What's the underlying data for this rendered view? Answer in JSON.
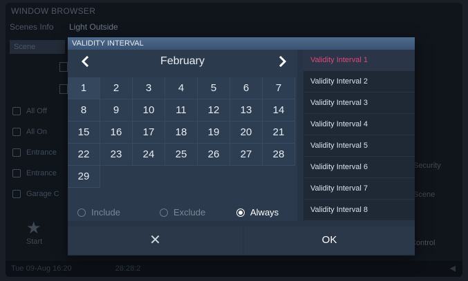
{
  "background": {
    "title": "WINDOW BROWSER",
    "row_label": "Scenes Info",
    "row_value": "Light Outside",
    "tab": "Scene",
    "items": [
      "All Off",
      "All On",
      "Entrance",
      "Entrance",
      "Garage C"
    ],
    "star_label": "Start",
    "right_labels": [
      "Security",
      "Scene",
      "Control"
    ],
    "status_left": "Tue 09-Aug  16:20",
    "status_mid": "28:28:2"
  },
  "dialog": {
    "header": "VALIDITY INTERVAL",
    "month": "February",
    "days": [
      "1",
      "2",
      "3",
      "4",
      "5",
      "6",
      "7",
      "8",
      "9",
      "10",
      "11",
      "12",
      "13",
      "14",
      "15",
      "16",
      "17",
      "18",
      "19",
      "20",
      "21",
      "22",
      "23",
      "24",
      "25",
      "26",
      "27",
      "28",
      "29"
    ],
    "options": [
      {
        "label": "Include",
        "selected": false
      },
      {
        "label": "Exclude",
        "selected": false
      },
      {
        "label": "Always",
        "selected": true
      }
    ],
    "intervals": [
      "Validity Interval 1",
      "Validity Interval 2",
      "Validity Interval 3",
      "Validity Interval 4",
      "Validity Interval 5",
      "Validity Interval 6",
      "Validity Interval 7",
      "Validity Interval 8"
    ],
    "active_interval_index": 0,
    "ok_label": "OK",
    "cancel_glyph": "✕",
    "accent_color": "#e0457b"
  }
}
